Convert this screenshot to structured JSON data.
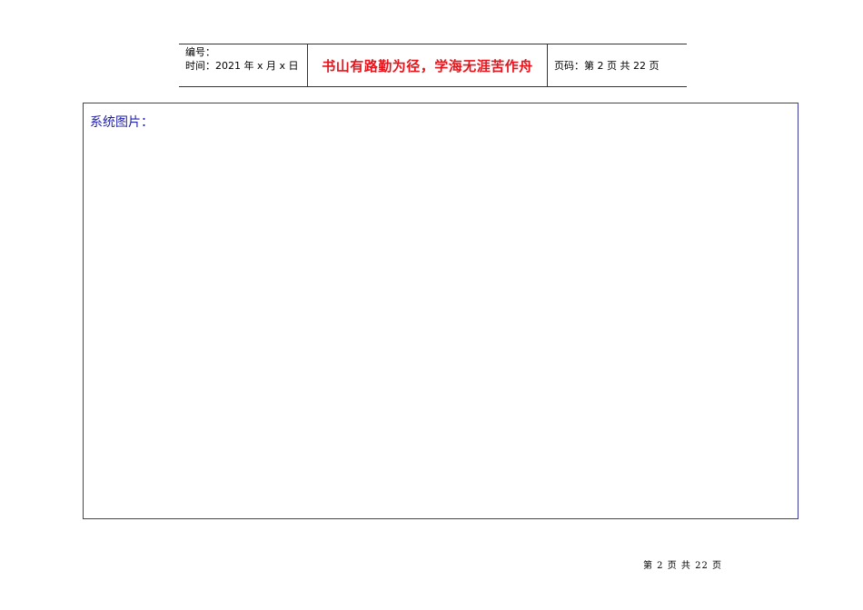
{
  "header": {
    "number_label": "编号：",
    "time_label": "时间：2021 年 x 月 x 日",
    "motto": "书山有路勤为径，学海无涯苦作舟",
    "page_info": "页码：第 2 页  共 22 页"
  },
  "content": {
    "label": "系统图片："
  },
  "footer": {
    "page_text": "第 2 页 共 22 页"
  },
  "colors": {
    "motto": "#e8141b",
    "label": "#2020b0",
    "box_border": "#3b3b9b"
  }
}
